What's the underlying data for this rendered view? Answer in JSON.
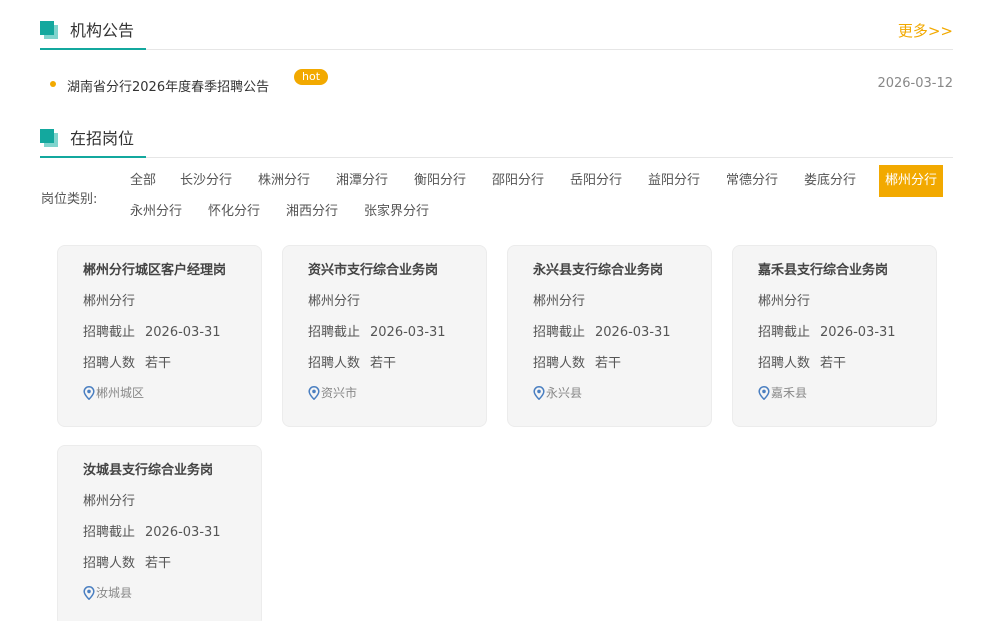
{
  "announcements": {
    "title": "机构公告",
    "more": "更多>>",
    "items": [
      {
        "title": "湖南省分行2026年度春季招聘公告",
        "badge": "hot",
        "date": "2026-03-12"
      }
    ]
  },
  "positions": {
    "title": "在招岗位",
    "category_label": "岗位类别:",
    "categories": [
      "全部",
      "长沙分行",
      "株洲分行",
      "湘潭分行",
      "衡阳分行",
      "邵阳分行",
      "岳阳分行",
      "益阳分行",
      "常德分行",
      "娄底分行",
      "郴州分行",
      "永州分行",
      "怀化分行",
      "湘西分行",
      "张家界分行"
    ],
    "active_category": "郴州分行",
    "field_labels": {
      "deadline": "招聘截止",
      "count": "招聘人数"
    },
    "jobs": [
      {
        "title": "郴州分行城区客户经理岗",
        "branch": "郴州分行",
        "deadline": "2026-03-31",
        "count": "若干",
        "location": "郴州城区"
      },
      {
        "title": "资兴市支行综合业务岗",
        "branch": "郴州分行",
        "deadline": "2026-03-31",
        "count": "若干",
        "location": "资兴市"
      },
      {
        "title": "永兴县支行综合业务岗",
        "branch": "郴州分行",
        "deadline": "2026-03-31",
        "count": "若干",
        "location": "永兴县"
      },
      {
        "title": "嘉禾县支行综合业务岗",
        "branch": "郴州分行",
        "deadline": "2026-03-31",
        "count": "若干",
        "location": "嘉禾县"
      },
      {
        "title": "汝城县支行综合业务岗",
        "branch": "郴州分行",
        "deadline": "2026-03-31",
        "count": "若干",
        "location": "汝城县"
      }
    ]
  },
  "colors": {
    "accent": "#13a89e",
    "highlight": "#f2a900",
    "card_bg": "#f5f5f5",
    "pin": "#4a7fc1"
  },
  "icons": {
    "location": "map-pin-icon",
    "section": "teal-square-icon"
  }
}
